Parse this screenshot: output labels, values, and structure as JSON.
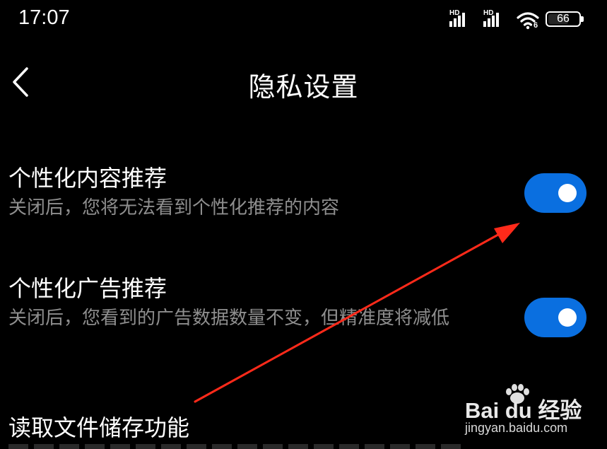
{
  "status_bar": {
    "time": "17:07",
    "signal1_label": "HD",
    "signal2_label": "HD",
    "wifi_badge": "6",
    "battery_level": "66"
  },
  "header": {
    "title": "隐私设置",
    "back_icon": "chevron-left-icon"
  },
  "settings": [
    {
      "title": "个性化内容推荐",
      "description": "关闭后，您将无法看到个性化推荐的内容",
      "enabled": true
    },
    {
      "title": "个性化广告推荐",
      "description": "关闭后，您看到的广告数据数量不变，但精准度将减低",
      "enabled": true
    },
    {
      "title": "读取文件储存功能"
    }
  ],
  "watermark": {
    "brand": "Bai du 经验",
    "url": "jingyan.baidu.com"
  },
  "colors": {
    "background": "#000000",
    "toggle_on": "#0a6fe0",
    "annotation_arrow": "#ff2a1a"
  }
}
